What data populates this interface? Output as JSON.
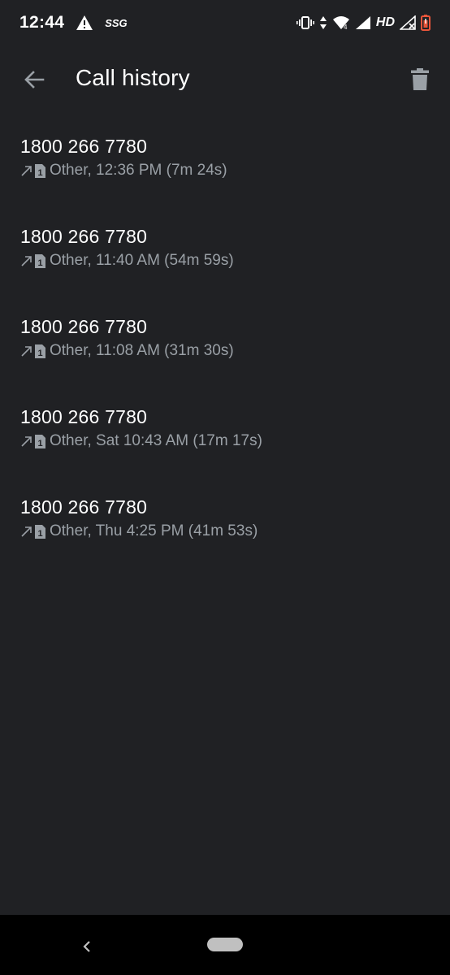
{
  "status_bar": {
    "time": "12:44",
    "carrier_badge": "SSG",
    "hd_label": "HD",
    "icons": [
      "warning-icon",
      "vibrate-icon",
      "data-arrows-icon",
      "wifi-icon",
      "signal-icon",
      "no-signal-icon",
      "battery-icon"
    ],
    "battery_color": "#e8553a"
  },
  "app_bar": {
    "title": "Call history",
    "back_icon": "arrow-back-icon",
    "delete_icon": "trash-icon"
  },
  "calls": [
    {
      "number": "1800 266 7780",
      "details": "Other, 12:36 PM (7m 24s)"
    },
    {
      "number": "1800 266 7780",
      "details": "Other, 11:40 AM (54m 59s)"
    },
    {
      "number": "1800 266 7780",
      "details": "Other, 11:08 AM (31m 30s)"
    },
    {
      "number": "1800 266 7780",
      "details": "Other, Sat 10:43 AM (17m 17s)"
    },
    {
      "number": "1800 266 7780",
      "details": "Other, Thu 4:25 PM (41m 53s)"
    }
  ],
  "call_type_icon": "outgoing-call-icon",
  "sim_label": "1",
  "colors": {
    "background": "#202124",
    "primary_text": "#ffffff",
    "secondary_text": "#9aa0a6",
    "nav_bar": "#000000"
  }
}
